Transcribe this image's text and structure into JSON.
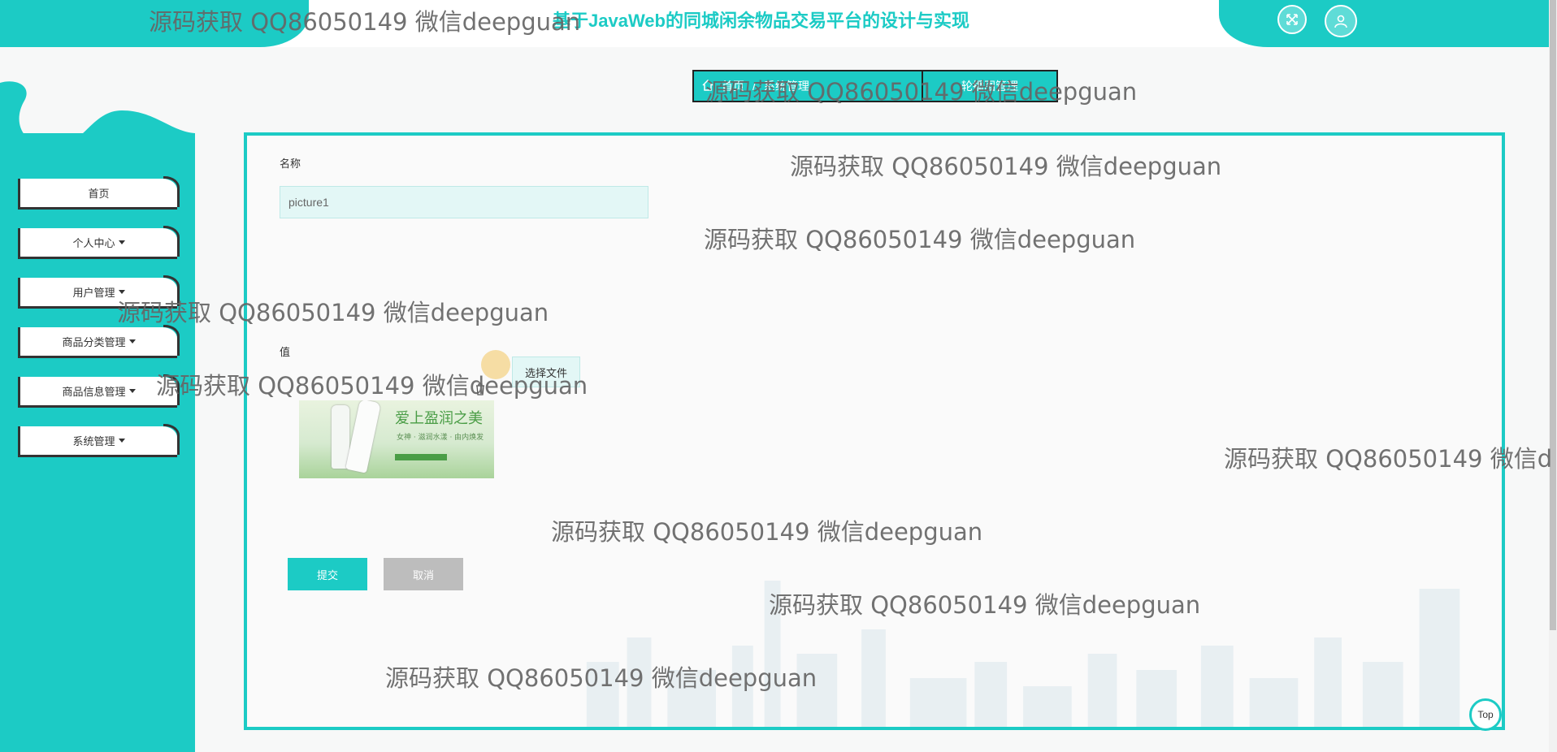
{
  "header": {
    "title": "基于JavaWeb的同城闲余物品交易平台的设计与实现",
    "icons": [
      "fullscreen-icon",
      "user-icon"
    ]
  },
  "breadcrumb": {
    "items": [
      "首页",
      "系统管理",
      "轮播图管理"
    ],
    "active": "轮播图管理",
    "separator": "/"
  },
  "sidebar": {
    "items": [
      {
        "label": "首页",
        "dropdown": false
      },
      {
        "label": "个人中心",
        "dropdown": true
      },
      {
        "label": "用户管理",
        "dropdown": true
      },
      {
        "label": "商品分类管理",
        "dropdown": true
      },
      {
        "label": "商品信息管理",
        "dropdown": true
      },
      {
        "label": "系统管理",
        "dropdown": true
      }
    ]
  },
  "form": {
    "name_label": "名称",
    "name_value": "picture1",
    "value_label": "值",
    "file_button": "选择文件",
    "image": {
      "headline": "爱上盈润之美",
      "subtitle": "女神 · 滋润水漾 · 由内焕发"
    },
    "submit": "提交",
    "cancel": "取消"
  },
  "top_button": "Top",
  "watermark": "源码获取 QQ86050149 微信deepguan",
  "watermark_clipped": "源码获取 QQ86050149 微信d",
  "colors": {
    "accent": "#1ccbc5",
    "cancel": "#bdbdbd",
    "input_bg": "#e3f7f6"
  }
}
